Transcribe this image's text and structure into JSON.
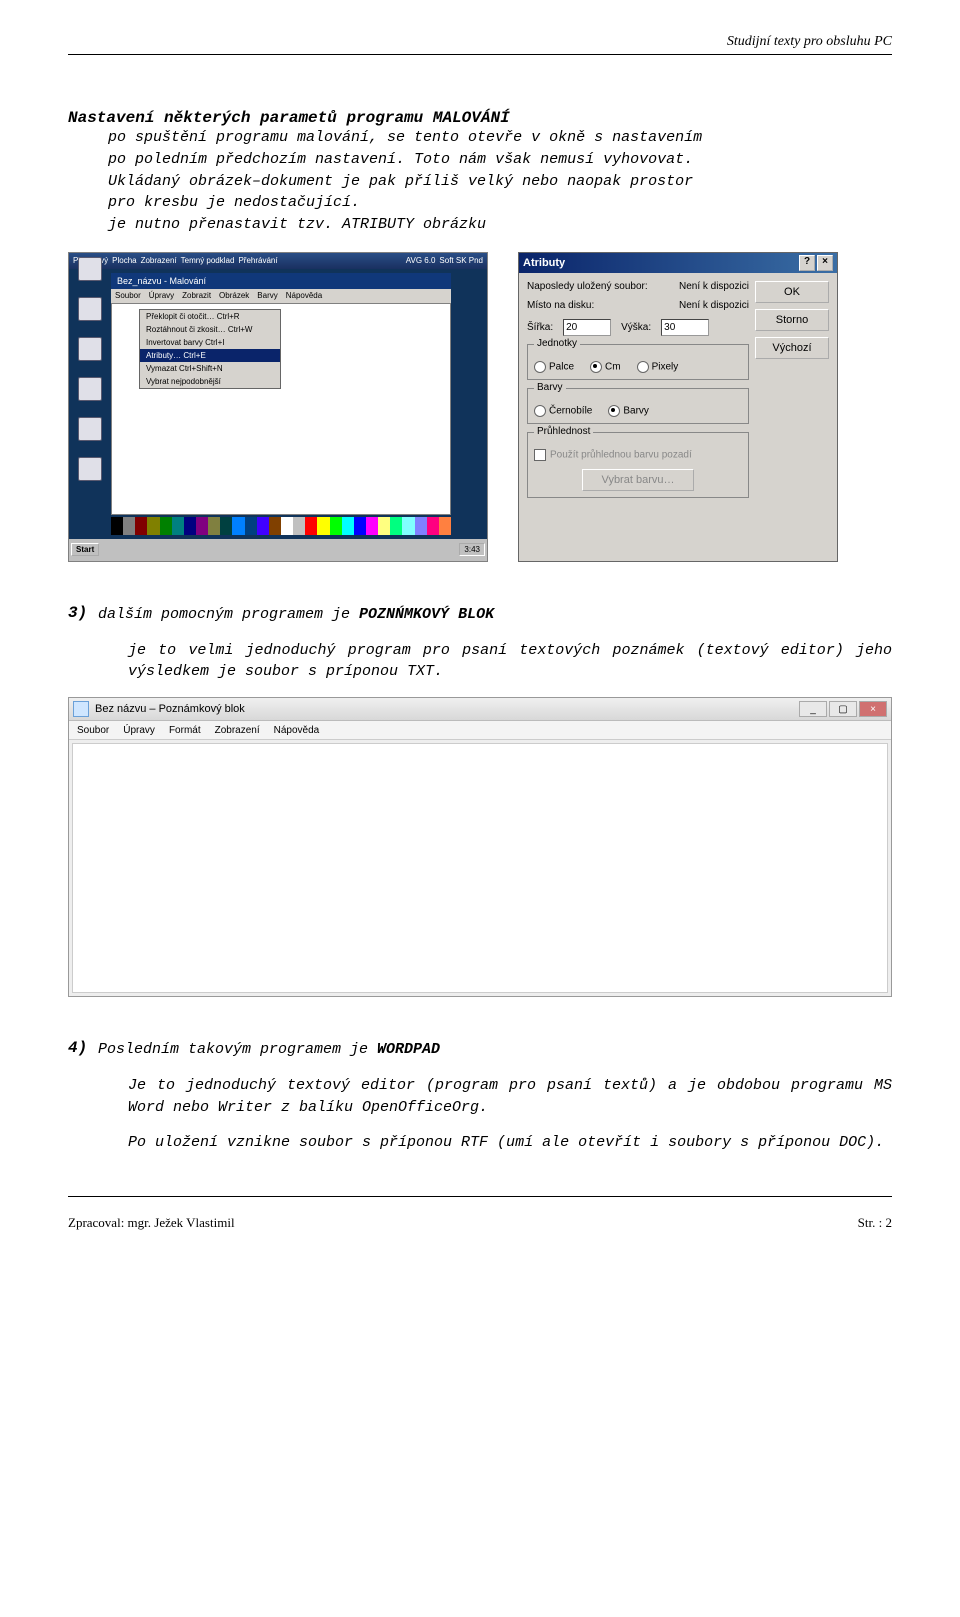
{
  "header": "Studijní texty pro obsluhu PC",
  "section_title": "Nastavení některých parametů programu MALOVÁNÍ",
  "p1a": "po spuštění programu malování, se tento otevře v okně s nastavením",
  "p1b": "po poledním předchozím nastavení. Toto nám však nemusí vyhovovat.",
  "p1c": "Ukládaný obrázek–dokument je pak příliš velký nebo naopak prostor",
  "p1d": "pro kresbu je nedostačující.",
  "p1e": "je nutno přenastavit tzv. ATRIBUTY obrázku",
  "paint": {
    "title": "Bez_názvu - Malování",
    "menu": [
      "Soubor",
      "Úpravy",
      "Zobrazit",
      "Obrázek",
      "Barvy",
      "Nápověda"
    ],
    "ctx": [
      "Překlopit či otočit…  Ctrl+R",
      "Roztáhnout či zkosit…  Ctrl+W",
      "Invertovat barvy  Ctrl+I",
      "Atributy…  Ctrl+E",
      "Vymazat  Ctrl+Shift+N",
      "Vybrat nejpodobnější"
    ],
    "ctx_hi": 3,
    "start": "Start",
    "time": "3:43",
    "topbar": [
      "Příkazový",
      "Plocha",
      "Zobrazení",
      "Temný podklad",
      "Přehrávání",
      "AVG 6.0",
      "Soft SK Pnd"
    ]
  },
  "attr": {
    "title": "Atributy",
    "info1_l": "Naposledy uložený soubor:",
    "info1_r": "Není k dispozici",
    "info2_l": "Místo na disku:",
    "info2_r": "Není k dispozici",
    "w_lbl": "Šířka:",
    "w_val": "20",
    "h_lbl": "Výška:",
    "h_val": "30",
    "g1": "Jednotky",
    "o_pal": "Palce",
    "o_cm": "Cm",
    "o_px": "Pixely",
    "g2": "Barvy",
    "o_bw": "Černobíle",
    "o_col": "Barvy",
    "g3": "Průhlednost",
    "chk": "Použít průhlednou barvu pozadí",
    "btn_pick": "Vybrat barvu…",
    "btns": [
      "OK",
      "Storno",
      "Výchozí"
    ]
  },
  "item3_num": "3)",
  "item3_txt_a": "dalším pomocným programem je ",
  "item3_txt_b": "POZNŃMKOVÝ BLOK",
  "item3_p1": "je to velmi jednoduchý program pro psaní textových poznámek (textový editor) jeho výsledkem je soubor s príponou TXT.",
  "notepad": {
    "title": "Bez názvu – Poznámkový blok",
    "menu": [
      "Soubor",
      "Úpravy",
      "Formát",
      "Zobrazení",
      "Nápověda"
    ]
  },
  "item4_num": "4)",
  "item4_txt_a": "Posledním takovým programem je ",
  "item4_txt_b": "WORDPAD",
  "item4_p1": "Je to jednoduchý textový editor (program pro psaní textů) a je obdobou programu MS Word nebo Writer z balíku OpenOfficeOrg.",
  "item4_p2": "Po uložení vznikne soubor s příponou RTF (umí ale otevřít i soubory s příponou DOC).",
  "footer_l": "Zpracoval: mgr. Ježek Vlastimil",
  "footer_r": "Str. : 2",
  "palette": [
    "#000",
    "#808080",
    "#800000",
    "#808000",
    "#008000",
    "#008080",
    "#000080",
    "#800080",
    "#808040",
    "#004040",
    "#0080ff",
    "#004080",
    "#4000ff",
    "#804000",
    "#fff",
    "#c0c0c0",
    "#f00",
    "#ff0",
    "#0f0",
    "#0ff",
    "#00f",
    "#f0f",
    "#ffff80",
    "#00ff80",
    "#80ffff",
    "#8080ff",
    "#ff0080",
    "#ff8040"
  ]
}
